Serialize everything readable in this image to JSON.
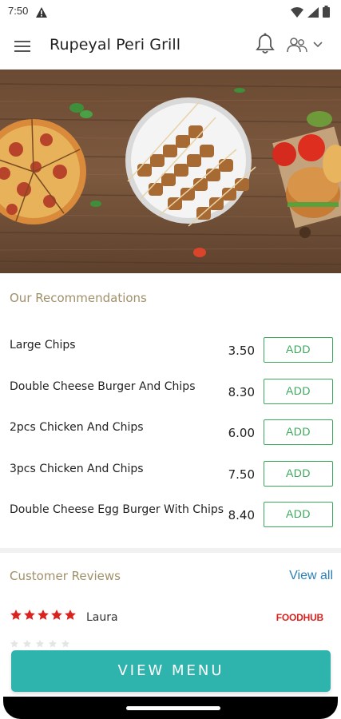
{
  "status_bar": {
    "time": "7:50"
  },
  "app_bar": {
    "title": "Rupeyal Peri Grill"
  },
  "recommendations": {
    "title": "Our Recommendations",
    "items": [
      {
        "name": "Large Chips",
        "price": "3.50",
        "action": "ADD"
      },
      {
        "name": "Double Cheese Burger And Chips",
        "price": "8.30",
        "action": "ADD"
      },
      {
        "name": "2pcs Chicken And Chips",
        "price": "6.00",
        "action": "ADD"
      },
      {
        "name": "3pcs Chicken And Chips",
        "price": "7.50",
        "action": "ADD"
      },
      {
        "name": "Double Cheese Egg Burger With Chips",
        "price": "8.40",
        "action": "ADD"
      }
    ]
  },
  "reviews": {
    "title": "Customer Reviews",
    "view_all": "View all",
    "items": [
      {
        "rating": 5,
        "reviewer": "Laura",
        "source": "FOODHUB"
      }
    ]
  },
  "cta": {
    "label": "VIEW MENU"
  },
  "colors": {
    "accent_teal": "#2fb3ad",
    "add_green": "#3aa85a",
    "section_title": "#a0906a",
    "star_red": "#d8231f",
    "link_blue": "#2a7fb8"
  }
}
